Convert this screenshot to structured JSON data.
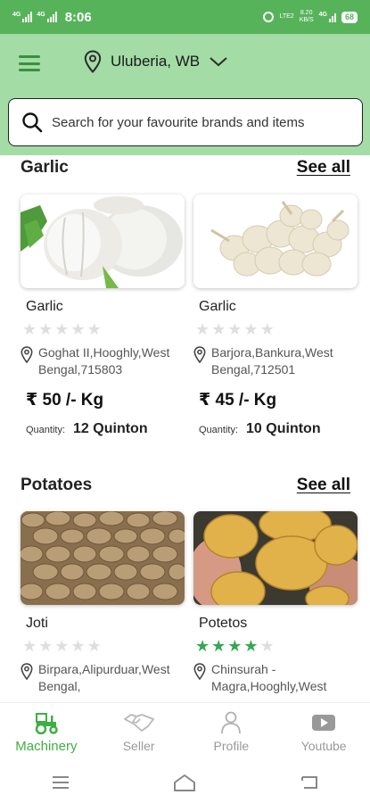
{
  "status_bar": {
    "time": "8:06",
    "sim1": "4G",
    "sim2": "4G",
    "net_speed_value": "8.20",
    "net_speed_unit": "KB/S",
    "volte": "LTE2",
    "data_type": "4G",
    "battery": "68"
  },
  "header": {
    "location": "Uluberia, WB",
    "search_placeholder": "Search for your favourite brands and items"
  },
  "sections": [
    {
      "title": "Garlic",
      "see_all": "See all",
      "products": [
        {
          "name": "Garlic",
          "rating": 0,
          "address": "Goghat II,Hooghly,West Bengal,715803",
          "price": "₹ 50 /- Kg",
          "quantity_label": "Quantity:",
          "quantity": "12 Quinton"
        },
        {
          "name": "Garlic",
          "rating": 0,
          "address": "Barjora,Bankura,West Bengal,712501",
          "price": "₹ 45 /- Kg",
          "quantity_label": "Quantity:",
          "quantity": "10 Quinton"
        }
      ]
    },
    {
      "title": "Potatoes",
      "see_all": "See all",
      "products": [
        {
          "name": "Joti",
          "rating": 0,
          "address": "Birpara,Alipurduar,West Bengal,"
        },
        {
          "name": "Potetos",
          "rating": 4,
          "address": "Chinsurah - Magra,Hooghly,West"
        }
      ]
    }
  ],
  "bottom_nav": [
    {
      "label": "Machinery",
      "icon": "tractor-icon",
      "active": true
    },
    {
      "label": "Seller",
      "icon": "handshake-icon",
      "active": false
    },
    {
      "label": "Profile",
      "icon": "person-icon",
      "active": false
    },
    {
      "label": "Youtube",
      "icon": "youtube-icon",
      "active": false
    }
  ],
  "colors": {
    "status_bar": "#56b35a",
    "header": "#a3dca5",
    "accent": "#3fae45",
    "star_filled": "#34a853",
    "star_empty": "#dedede"
  }
}
